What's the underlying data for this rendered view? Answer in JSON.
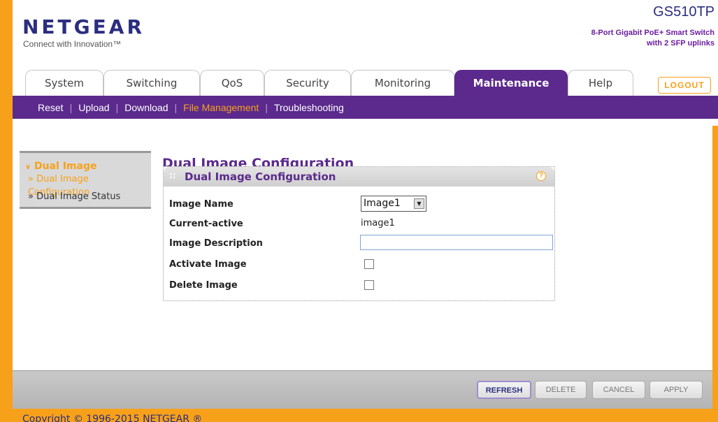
{
  "brand": {
    "logo": "NETGEAR",
    "tagline": "Connect with Innovation™",
    "model": "GS510TP",
    "model_desc_line1": "8-Port Gigabit PoE+ Smart Switch",
    "model_desc_line2": "with 2 SFP uplinks"
  },
  "tabs": [
    "System",
    "Switching",
    "QoS",
    "Security",
    "Monitoring",
    "Maintenance",
    "Help"
  ],
  "active_tab": "Maintenance",
  "logout_label": "LOGOUT",
  "subnav": [
    "Reset",
    "Upload",
    "Download",
    "File Management",
    "Troubleshooting"
  ],
  "subnav_current": "File Management",
  "leftnav": {
    "head": "Dual Image",
    "items": [
      "» Dual Image Configuration",
      "» Dual Image Status"
    ]
  },
  "main": {
    "page_title": "Dual Image Configuration",
    "panel_title": "Dual Image Configuration",
    "help_icon": "?",
    "fields": {
      "image_name_label": "Image Name",
      "image_name_value": "Image1",
      "current_active_label": "Current-active",
      "current_active_value": "image1",
      "image_description_label": "Image Description",
      "image_description_value": "",
      "activate_image_label": "Activate Image",
      "delete_image_label": "Delete Image"
    }
  },
  "buttons": {
    "refresh": "REFRESH",
    "delete": "DELETE",
    "cancel": "CANCEL",
    "apply": "APPLY"
  },
  "footer": {
    "copyright": "Copyright © 1996-2015 NETGEAR ®"
  },
  "colors": {
    "brand_purple": "#5b2a8c",
    "brand_orange": "#f7a11b",
    "logo_blue": "#2b2e7f"
  }
}
